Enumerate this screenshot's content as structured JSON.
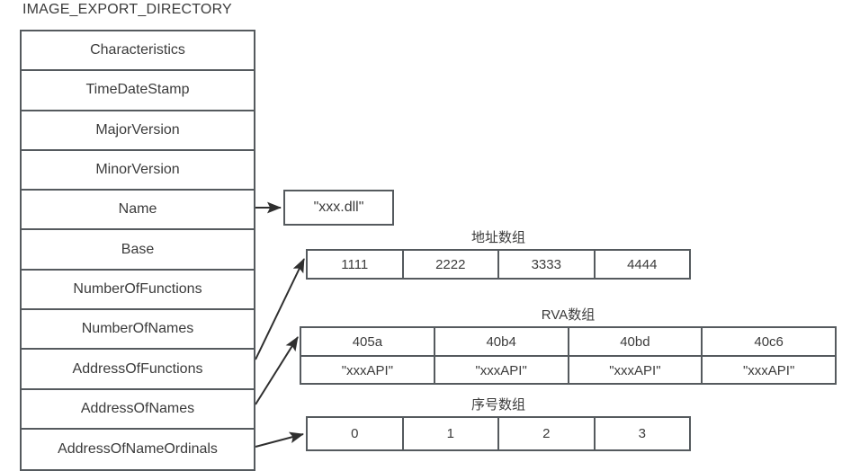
{
  "diagram": {
    "title": "IMAGE_EXPORT_DIRECTORY",
    "line_color": "#555a5e",
    "text_color": "#3b3b3b",
    "background": "#ffffff"
  },
  "struct": {
    "name": "IMAGE_EXPORT_DIRECTORY",
    "fields": [
      {
        "label": "Characteristics"
      },
      {
        "label": "TimeDateStamp"
      },
      {
        "label": "MajorVersion"
      },
      {
        "label": "MinorVersion"
      },
      {
        "label": "Name"
      },
      {
        "label": "Base"
      },
      {
        "label": "NumberOfFunctions"
      },
      {
        "label": "NumberOfNames"
      },
      {
        "label": "AddressOfFunctions"
      },
      {
        "label": "AddressOfNames"
      },
      {
        "label": "AddressOfNameOrdinals"
      }
    ]
  },
  "dll_name_box": {
    "value": "\"xxx.dll\""
  },
  "address_array": {
    "caption": "地址数组",
    "values": [
      "1111",
      "2222",
      "3333",
      "4444"
    ]
  },
  "rva_array": {
    "caption": "RVA数组",
    "values": [
      "405a",
      "40b4",
      "40bd",
      "40c6"
    ],
    "names": [
      "\"xxxAPI\"",
      "\"xxxAPI\"",
      "\"xxxAPI\"",
      "\"xxxAPI\""
    ]
  },
  "ordinal_array": {
    "caption": "序号数组",
    "values": [
      "0",
      "1",
      "2",
      "3"
    ]
  },
  "connectors": [
    {
      "from": "Name",
      "to": "dll-name-box"
    },
    {
      "from": "AddressOfFunctions",
      "to": "address-array"
    },
    {
      "from": "AddressOfNames",
      "to": "rva-array"
    },
    {
      "from": "AddressOfNameOrdinals",
      "to": "ordinal-array"
    }
  ]
}
